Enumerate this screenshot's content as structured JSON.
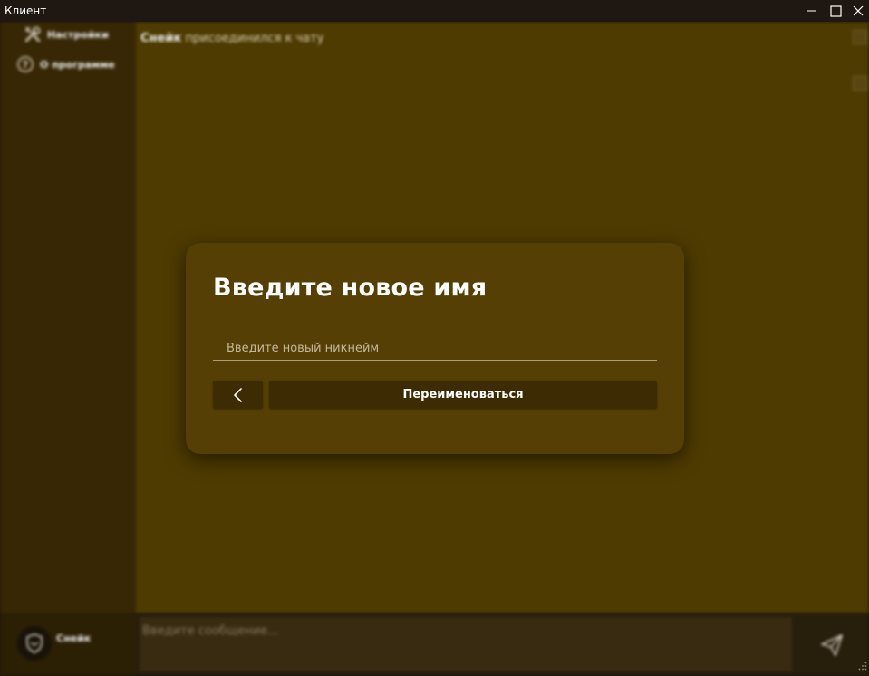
{
  "window": {
    "title": "Клиент"
  },
  "sidebar": {
    "items": [
      {
        "label": "Настройки",
        "icon": "tools-icon"
      },
      {
        "label": "О программе",
        "icon": "help-circle-icon"
      }
    ]
  },
  "chat": {
    "messages": [
      {
        "user": "Снейк",
        "text": "присоединился к чату"
      }
    ]
  },
  "user_panel": {
    "name": "Снейк",
    "avatar_icon": "shield-icon"
  },
  "message_input": {
    "placeholder": "Введите сообщение..."
  },
  "dialog": {
    "title": "Введите новое имя",
    "nickname_input": {
      "value": "",
      "placeholder": "Введите новый никнейм"
    },
    "back_icon": "chevron-left-icon",
    "rename_label": "Переименоваться"
  },
  "colors": {
    "sidebar": "#3b2a05",
    "chat_background": "#533f02",
    "dialog_background": "#553f04",
    "button_background": "#3c2b03",
    "title_bar": "#1f1812"
  }
}
